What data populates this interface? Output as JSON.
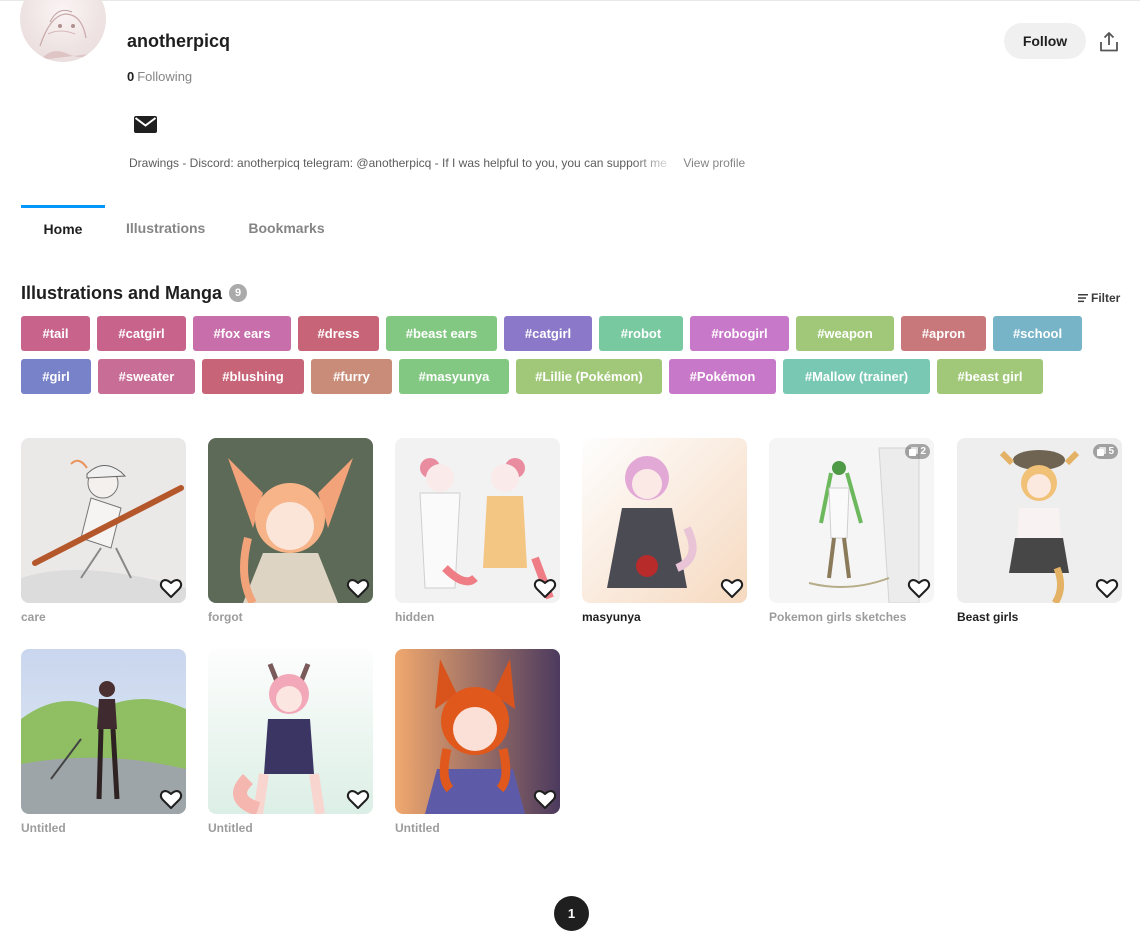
{
  "profile": {
    "username": "anotherpicq",
    "following_count": "0",
    "following_label": "Following",
    "bio": "Drawings - Discord: anotherpicq telegram: @anotherpicq - If I was helpful to you, you can support me",
    "view_profile": "View profile",
    "follow_label": "Follow"
  },
  "tabs": [
    {
      "label": "Home"
    },
    {
      "label": "Illustrations"
    },
    {
      "label": "Bookmarks"
    }
  ],
  "section": {
    "title": "Illustrations and Manga",
    "count": "9",
    "filter_label": "Filter"
  },
  "tags": [
    {
      "label": "#tail",
      "color": "#c8648c"
    },
    {
      "label": "#catgirl",
      "color": "#c8648c"
    },
    {
      "label": "#fox ears",
      "color": "#c86eaa"
    },
    {
      "label": "#dress",
      "color": "#c86478"
    },
    {
      "label": "#beast ears",
      "color": "#82c882"
    },
    {
      "label": "#catgirl",
      "color": "#8c78c8"
    },
    {
      "label": "#robot",
      "color": "#78c8a0"
    },
    {
      "label": "#robogirl",
      "color": "#c878c8"
    },
    {
      "label": "#weapon",
      "color": "#a0c878"
    },
    {
      "label": "#apron",
      "color": "#c8787a"
    },
    {
      "label": "#school",
      "color": "#78b4c8"
    },
    {
      "label": "#girl",
      "color": "#7882c8"
    },
    {
      "label": "#sweater",
      "color": "#c86e96"
    },
    {
      "label": "#blushing",
      "color": "#c86478"
    },
    {
      "label": "#furry",
      "color": "#c88c78"
    },
    {
      "label": "#masyunya",
      "color": "#82c882"
    },
    {
      "label": "#Lillie (Pokémon)",
      "color": "#a0c878"
    },
    {
      "label": "#Pokémon",
      "color": "#c878c8"
    },
    {
      "label": "#Mallow (trainer)",
      "color": "#78c8b4"
    },
    {
      "label": "#beast girl",
      "color": "#a0c878"
    }
  ],
  "works": [
    {
      "title": "care",
      "pages": ""
    },
    {
      "title": "forgot",
      "pages": ""
    },
    {
      "title": "hidden",
      "pages": ""
    },
    {
      "title": "masyunya",
      "pages": ""
    },
    {
      "title": "Pokemon girls sketches",
      "pages": "2"
    },
    {
      "title": "Beast girls",
      "pages": "5"
    },
    {
      "title": "Untitled",
      "pages": ""
    },
    {
      "title": "Untitled",
      "pages": ""
    },
    {
      "title": "Untitled",
      "pages": ""
    }
  ],
  "pagination": {
    "current": "1"
  },
  "icons": {
    "contact": "mail-icon",
    "share": "share-icon",
    "filter": "filter-icon",
    "bookmark": "heart-icon",
    "multi_page": "pages-icon"
  },
  "colors": {
    "accent": "#0096fa",
    "follow_button_bg": "#f0f0f0",
    "pager_bg": "#1f1f1f"
  }
}
